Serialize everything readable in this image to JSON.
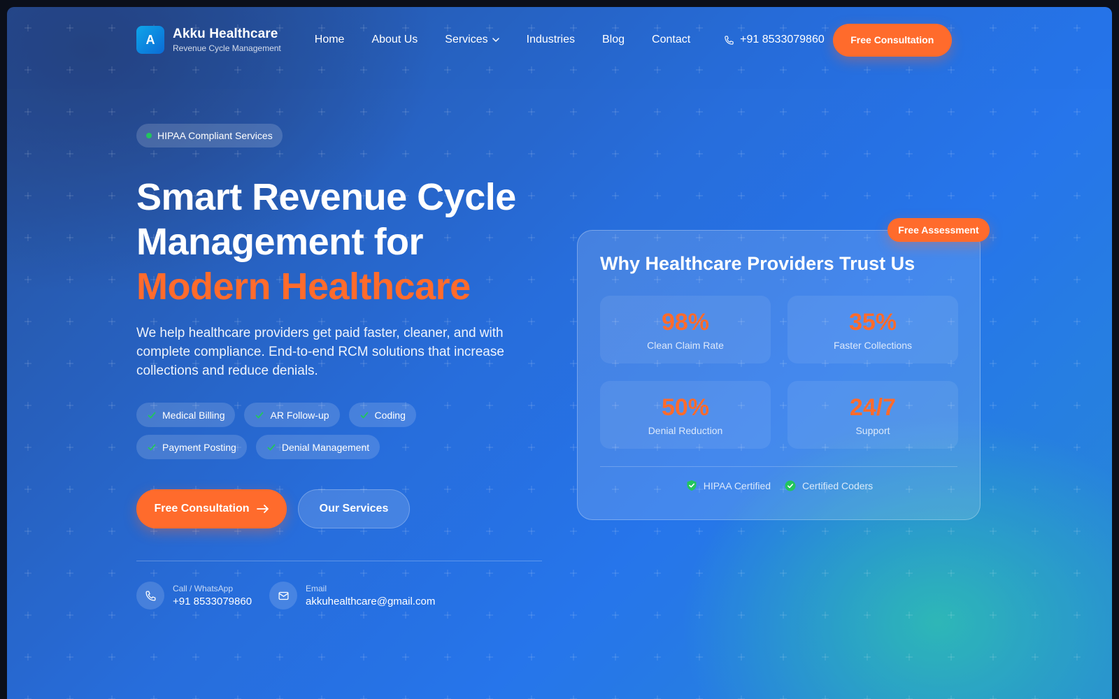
{
  "brand": {
    "logo_letter": "A",
    "name": "Akku Healthcare",
    "tagline": "Revenue Cycle Management"
  },
  "nav": {
    "items": [
      {
        "label": "Home"
      },
      {
        "label": "About Us"
      },
      {
        "label": "Services",
        "has_dropdown": true
      },
      {
        "label": "Industries"
      },
      {
        "label": "Blog"
      },
      {
        "label": "Contact"
      }
    ],
    "phone": "+91 8533079860",
    "cta": "Free Consultation"
  },
  "hero": {
    "badge": "HIPAA Compliant Services",
    "headline_line1": "Smart Revenue Cycle",
    "headline_line2": "Management for",
    "headline_accent": "Modern Healthcare",
    "lead": "We help healthcare providers get paid faster, cleaner, and with complete compliance. End-to-end RCM solutions that increase collections and reduce denials.",
    "chips": [
      "Medical Billing",
      "AR Follow-up",
      "Coding",
      "Payment Posting",
      "Denial Management"
    ],
    "primary_cta": "Free Consultation",
    "secondary_cta": "Our Services",
    "contacts": {
      "phone_label": "Call / WhatsApp",
      "phone_value": "+91 8533079860",
      "email_label": "Email",
      "email_value": "akkuhealthcare@gmail.com"
    }
  },
  "trust_card": {
    "tag": "Free Assessment",
    "title": "Why Healthcare Providers Trust Us",
    "stats": [
      {
        "value": "98%",
        "label": "Clean Claim Rate"
      },
      {
        "value": "35%",
        "label": "Faster Collections"
      },
      {
        "value": "50%",
        "label": "Denial Reduction"
      },
      {
        "value": "24/7",
        "label": "Support"
      }
    ],
    "certs": [
      "HIPAA Certified",
      "Certified Coders"
    ]
  },
  "colors": {
    "accent": "#ff6b2c",
    "success": "#22c55e",
    "brand_blue": "#0b5ad6"
  },
  "icons": [
    "phone-icon",
    "chevron-down-icon",
    "check-icon",
    "arrow-right-icon",
    "mail-icon",
    "shield-check-icon",
    "check-circle-icon"
  ]
}
